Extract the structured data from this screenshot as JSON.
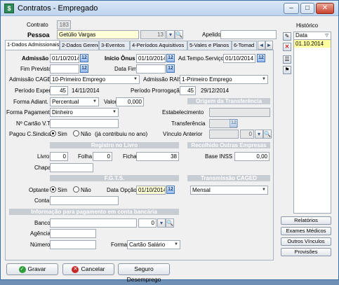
{
  "window": {
    "title": "Contratos - Empregado",
    "min": "–",
    "max": "□",
    "close": "✕"
  },
  "header": {
    "contrato_label": "Contrato",
    "contrato_value": "183",
    "pessoa_label": "Pessoa",
    "pessoa_value": "Getúlio Vargas",
    "pessoa_code": "13",
    "apelido_label": "Apelido",
    "apelido_value": ""
  },
  "tabs": [
    "1-Dados Admissionais",
    "2-Dados Gerenciais",
    "3-Eventos",
    "4-Períodos Aquisitivos",
    "5-Vales e Planos",
    "6-Tomad"
  ],
  "tab_arrows": {
    "left": "◄",
    "right": "►"
  },
  "form": {
    "admissao_label": "Admissão",
    "admissao_value": "01/10/2014",
    "inicio_onus_label": "Início Ônus",
    "inicio_onus_value": "01/10/2014",
    "ad_tempo_label": "Ad.Tempo.Serviço",
    "ad_tempo_value": "01/10/2014",
    "fim_previsto_label": "Fim Previsto",
    "fim_previsto_value": "",
    "data_fim_label": "Data Fim",
    "data_fim_value": "",
    "adm_caged_label": "Admissão CAGED",
    "adm_caged_value": "10-Primeiro Emprego",
    "adm_rais_label": "Admissão RAIS",
    "adm_rais_value": "1-Primeiro Emprego",
    "periodo_exper_label": "Período Exper.",
    "periodo_exper_value": "45",
    "periodo_exper_date": "14/11/2014",
    "periodo_prorrog_label": "Período Prorrogação",
    "periodo_prorrog_value": "45",
    "periodo_prorrog_date": "29/12/2014",
    "forma_adiant_label": "Forma Adiant.",
    "forma_adiant_value": "Percentual",
    "valor_label": "Valor",
    "valor_value": "0,000",
    "forma_pag_label": "Forma Pagamento",
    "forma_pag_value": "Dinheiro",
    "cartao_vt_label": "Nº Cartão V.T.",
    "cartao_vt_value": "",
    "pagou_label": "Pagou C.Sindical",
    "sim_label": "Sim",
    "nao_label": "Não",
    "pagou_note": "(já contribuiu no ano)"
  },
  "origem": {
    "title": "Origem da Transferência",
    "estabelecimento_label": "Estabelecimento",
    "transferencia_label": "Transferência",
    "vinculo_label": "Vínculo Anterior",
    "vinculo_code": "0"
  },
  "registro": {
    "title": "Registro no Livro",
    "livro_label": "Livro",
    "livro_value": "0",
    "folha_label": "Folha",
    "folha_value": "0",
    "ficha_label": "Ficha",
    "ficha_value": "38",
    "chapa_label": "Chapa",
    "chapa_value": ""
  },
  "recolhido": {
    "title": "Recolhido Outras Empresas",
    "base_label": "Base INSS",
    "base_value": "0,00"
  },
  "fgts": {
    "title": "F.G.T.S.",
    "optante_label": "Optante",
    "sim_label": "Sim",
    "nao_label": "Não",
    "data_opcao_label": "Data Opção",
    "data_opcao_value": "01/10/2014",
    "conta_label": "Conta",
    "conta_value": ""
  },
  "caged": {
    "title": "Transmissão CAGED",
    "value": "Mensal"
  },
  "banco": {
    "title": "Informação para pagamento em conta bancária",
    "banco_label": "Banco",
    "banco_code": "0",
    "agencia_label": "Agência",
    "numero_label": "Número",
    "forma_label": "Forma",
    "forma_value": "Cartão Salário"
  },
  "historico": {
    "title": "Histórico",
    "col_data": "Data",
    "rows": [
      "01.10.2014"
    ]
  },
  "right_buttons": [
    "Relatórios",
    "Exames Médicos",
    "Outros Vínculos",
    "Provisões"
  ],
  "bottom_buttons": {
    "gravar": "Gravar",
    "cancelar": "Cancelar",
    "seguro": "Seguro Desemprego"
  },
  "colors": {
    "section_header": "#c8cdd4",
    "selected_row": "#ffffa0",
    "accent": "#3b6ea5"
  }
}
